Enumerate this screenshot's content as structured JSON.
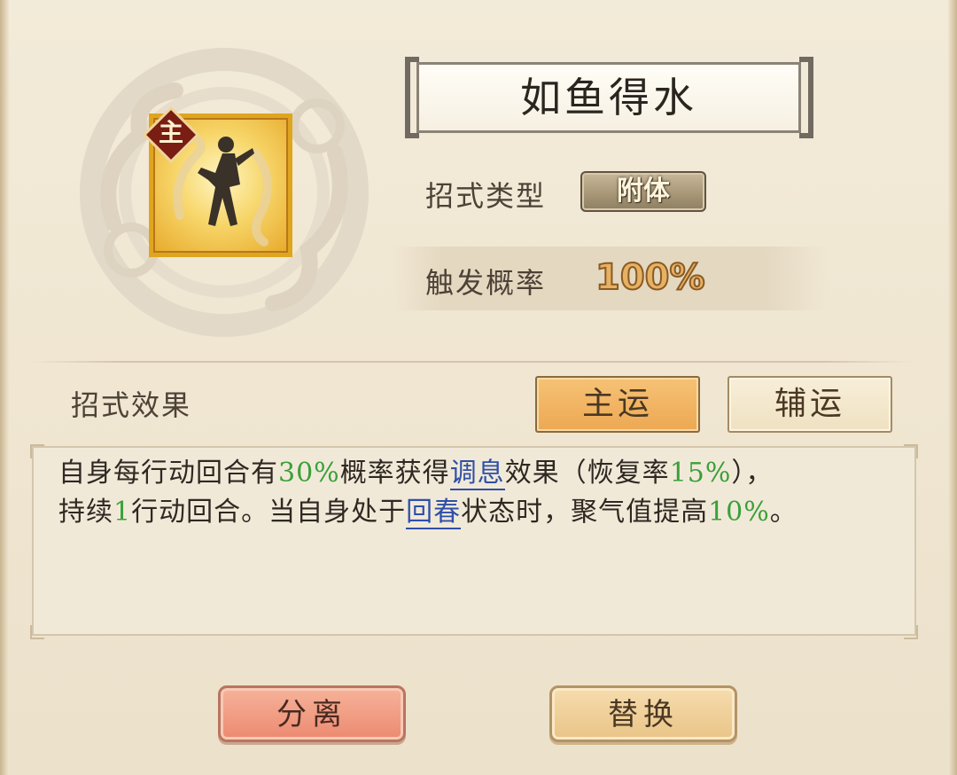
{
  "skill": {
    "name": "如鱼得水",
    "badge": "主",
    "icon": "dancer-silhouette-icon"
  },
  "info": {
    "type_label": "招式类型",
    "type_value": "附体",
    "rate_label": "触发概率",
    "rate_value": "100%"
  },
  "effect": {
    "section_label": "招式效果",
    "tabs": [
      {
        "label": "主运",
        "active": true
      },
      {
        "label": "辅运",
        "active": false
      }
    ],
    "line1": [
      {
        "t": "自身每行动回合有",
        "s": "n"
      },
      {
        "t": "30%",
        "s": "g"
      },
      {
        "t": "概率获得",
        "s": "n"
      },
      {
        "t": "调息",
        "s": "k"
      },
      {
        "t": "效果（恢复率",
        "s": "n"
      },
      {
        "t": "15%",
        "s": "g"
      },
      {
        "t": "），",
        "s": "n"
      }
    ],
    "line2": [
      {
        "t": "持续",
        "s": "n"
      },
      {
        "t": "1",
        "s": "g"
      },
      {
        "t": "行动回合。当自身处于",
        "s": "n"
      },
      {
        "t": "回春",
        "s": "k"
      },
      {
        "t": "状态时，聚气值提高",
        "s": "n"
      },
      {
        "t": "10%",
        "s": "g"
      },
      {
        "t": "。",
        "s": "n"
      }
    ]
  },
  "actions": {
    "detach_label": "分离",
    "replace_label": "替换"
  },
  "colors": {
    "highlight_green": "#3aa03a",
    "link_blue": "#2f4fa8",
    "active_tab": "#f0b060"
  }
}
